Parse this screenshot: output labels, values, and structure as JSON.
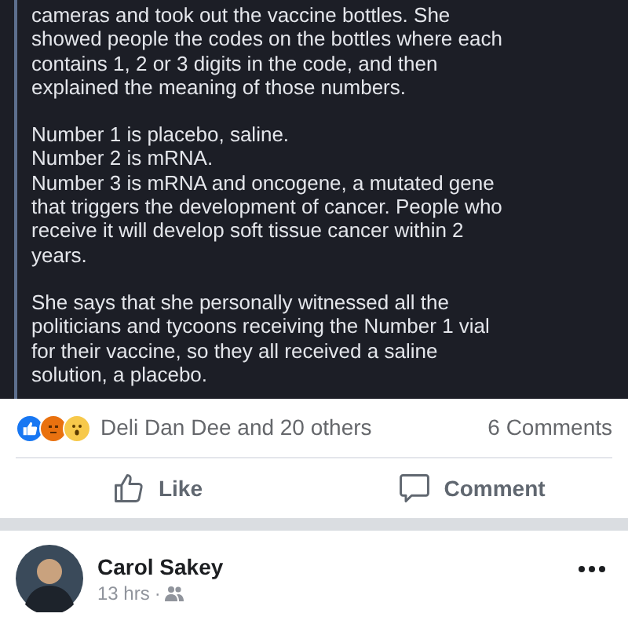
{
  "post_screenshot": {
    "paragraphs": [
      "cameras and took out the vaccine bottles. She\nshowed people the codes on the bottles where each\ncontains 1, 2 or 3 digits in the code, and then\nexplained the meaning of those numbers.",
      "Number 1 is placebo, saline.\nNumber 2 is mRNA.\nNumber 3 is mRNA and oncogene, a mutated gene\nthat triggers the development of cancer. People who\nreceive it will develop soft tissue cancer within 2\nyears.",
      "She says that she personally witnessed all the\npoliticians and tycoons receiving the Number 1 vial\nfor their vaccine, so they all received a saline\nsolution, a placebo."
    ]
  },
  "reactions": {
    "summary": "Deli Dan Dee and 20 others",
    "comments": "6 Comments"
  },
  "actions": [
    {
      "kind": "like",
      "label": "Like"
    },
    {
      "kind": "comment",
      "label": "Comment"
    }
  ],
  "next_post": {
    "author": "Carol Sakey",
    "time": "13 hrs",
    "separator": "·"
  }
}
